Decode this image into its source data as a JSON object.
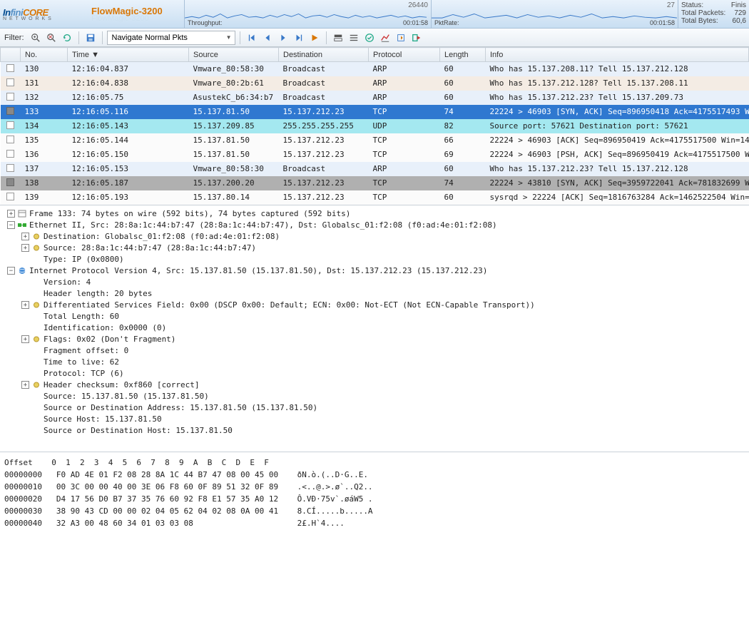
{
  "logo": {
    "in": "In",
    "fini": "fini",
    "core": "CORE",
    "sub": "N E T W O R K S"
  },
  "product": {
    "name": "FlowMagic-3200",
    "shadow": "FlowMagic-3200"
  },
  "stats": {
    "throughput": {
      "value": "26440",
      "label": "Throughput:",
      "time": "00:01:58"
    },
    "pktrate": {
      "value": "27",
      "label": "PktRate:",
      "time": "00:01:58"
    }
  },
  "status": {
    "status_label": "Status:",
    "status_val": "Finis",
    "packets_label": "Total Packets:",
    "packets_val": "729",
    "bytes_label": "Total Bytes:",
    "bytes_val": "60,6"
  },
  "toolbar": {
    "filter_label": "Filter:",
    "nav_select": "Navigate Normal Pkts"
  },
  "columns": {
    "check": " ",
    "no": "No.",
    "time": "Time ▼",
    "source": "Source",
    "dest": "Destination",
    "proto": "Protocol",
    "len": "Length",
    "info": "Info"
  },
  "packets": [
    {
      "chk": false,
      "cls": "row-lightblue",
      "no": "130",
      "time": "12:16:04.837",
      "src": "Vmware_80:58:30",
      "dst": "Broadcast",
      "proto": "ARP",
      "len": "60",
      "info": "Who has 15.137.208.11? Tell 15.137.212.128"
    },
    {
      "chk": false,
      "cls": "row-pale",
      "no": "131",
      "time": "12:16:04.838",
      "src": "Vmware_80:2b:61",
      "dst": "Broadcast",
      "proto": "ARP",
      "len": "60",
      "info": "Who has 15.137.212.128? Tell 15.137.208.11"
    },
    {
      "chk": false,
      "cls": "row-lightblue",
      "no": "132",
      "time": "12:16:05.75",
      "src": "AsustekC_b6:34:b7",
      "dst": "Broadcast",
      "proto": "ARP",
      "len": "60",
      "info": "Who has 15.137.212.23? Tell 15.137.209.73"
    },
    {
      "chk": true,
      "cls": "row-selected",
      "no": "133",
      "time": "12:16:05.116",
      "src": "15.137.81.50",
      "dst": "15.137.212.23",
      "proto": "TCP",
      "len": "74",
      "info": "22224 > 46903 [SYN, ACK] Seq=896950418 Ack=4175517493 W"
    },
    {
      "chk": false,
      "cls": "row-cyan",
      "no": "134",
      "time": "12:16:05.143",
      "src": "15.137.209.85",
      "dst": "255.255.255.255",
      "proto": "UDP",
      "len": "82",
      "info": "Source port: 57621 Destination port: 57621"
    },
    {
      "chk": false,
      "cls": "row-white",
      "no": "135",
      "time": "12:16:05.144",
      "src": "15.137.81.50",
      "dst": "15.137.212.23",
      "proto": "TCP",
      "len": "66",
      "info": "22224 > 46903 [ACK] Seq=896950419 Ack=4175517500 Win=14"
    },
    {
      "chk": false,
      "cls": "row-white",
      "no": "136",
      "time": "12:16:05.150",
      "src": "15.137.81.50",
      "dst": "15.137.212.23",
      "proto": "TCP",
      "len": "69",
      "info": "22224 > 46903 [PSH, ACK] Seq=896950419 Ack=4175517500 W"
    },
    {
      "chk": false,
      "cls": "row-lightblue",
      "no": "137",
      "time": "12:16:05.153",
      "src": "Vmware_80:58:30",
      "dst": "Broadcast",
      "proto": "ARP",
      "len": "60",
      "info": "Who has 15.137.212.23? Tell 15.137.212.128"
    },
    {
      "chk": true,
      "cls": "row-gray",
      "no": "138",
      "time": "12:16:05.187",
      "src": "15.137.200.20",
      "dst": "15.137.212.23",
      "proto": "TCP",
      "len": "74",
      "info": "22224 > 43810 [SYN, ACK] Seq=3959722041 Ack=781832699 W"
    },
    {
      "chk": false,
      "cls": "row-white",
      "no": "139",
      "time": "12:16:05.193",
      "src": "15.137.80.14",
      "dst": "15.137.212.23",
      "proto": "TCP",
      "len": "60",
      "info": "sysrqd > 22224 [ACK] Seq=1816763284 Ack=1462522504 Win="
    }
  ],
  "details": [
    {
      "indent": 0,
      "tree": "plus",
      "icon": "frame",
      "text": "Frame 133: 74 bytes on wire (592 bits), 74 bytes captured (592 bits)"
    },
    {
      "indent": 0,
      "tree": "minus",
      "icon": "eth",
      "text": "Ethernet II, Src: 28:8a:1c:44:b7:47 (28:8a:1c:44:b7:47), Dst: Globalsc_01:f2:08 (f0:ad:4e:01:f2:08)"
    },
    {
      "indent": 1,
      "tree": "plus",
      "icon": "dot",
      "text": "Destination: Globalsc_01:f2:08 (f0:ad:4e:01:f2:08)"
    },
    {
      "indent": 1,
      "tree": "plus",
      "icon": "dot",
      "text": "Source: 28:8a:1c:44:b7:47 (28:8a:1c:44:b7:47)"
    },
    {
      "indent": 1,
      "tree": "none",
      "icon": "none",
      "text": "Type: IP (0x0800)"
    },
    {
      "indent": 0,
      "tree": "minus",
      "icon": "ip",
      "text": "Internet Protocol Version 4, Src: 15.137.81.50 (15.137.81.50), Dst: 15.137.212.23 (15.137.212.23)"
    },
    {
      "indent": 1,
      "tree": "none",
      "icon": "none",
      "text": "Version: 4"
    },
    {
      "indent": 1,
      "tree": "none",
      "icon": "none",
      "text": "Header length: 20 bytes"
    },
    {
      "indent": 1,
      "tree": "plus",
      "icon": "dot",
      "text": "Differentiated Services Field: 0x00 (DSCP 0x00: Default; ECN: 0x00: Not-ECT (Not ECN-Capable Transport))"
    },
    {
      "indent": 1,
      "tree": "none",
      "icon": "none",
      "text": "Total Length: 60"
    },
    {
      "indent": 1,
      "tree": "none",
      "icon": "none",
      "text": "Identification: 0x0000 (0)"
    },
    {
      "indent": 1,
      "tree": "plus",
      "icon": "dot",
      "text": "Flags: 0x02 (Don't Fragment)"
    },
    {
      "indent": 1,
      "tree": "none",
      "icon": "none",
      "text": "Fragment offset: 0"
    },
    {
      "indent": 1,
      "tree": "none",
      "icon": "none",
      "text": "Time to live: 62"
    },
    {
      "indent": 1,
      "tree": "none",
      "icon": "none",
      "text": "Protocol: TCP (6)"
    },
    {
      "indent": 1,
      "tree": "plus",
      "icon": "dot",
      "text": "Header checksum: 0xf860 [correct]"
    },
    {
      "indent": 1,
      "tree": "none",
      "icon": "none",
      "text": "Source: 15.137.81.50 (15.137.81.50)"
    },
    {
      "indent": 1,
      "tree": "none",
      "icon": "none",
      "text": "Source or Destination Address: 15.137.81.50 (15.137.81.50)"
    },
    {
      "indent": 1,
      "tree": "none",
      "icon": "none",
      "text": "Source Host: 15.137.81.50"
    },
    {
      "indent": 1,
      "tree": "none",
      "icon": "none",
      "text": "Source or Destination Host: 15.137.81.50"
    }
  ],
  "hex": {
    "header": "Offset    0  1  2  3  4  5  6  7  8  9  A  B  C  D  E  F",
    "rows": [
      {
        "off": "00000000",
        "bytes": "F0 AD 4E 01 F2 08 28 8A 1C 44 B7 47 08 00 45 00",
        "ascii": "ðN.ò.(..D·G..E."
      },
      {
        "off": "00000010",
        "bytes": "00 3C 00 00 40 00 3E 06 F8 60 0F 89 51 32 0F 89",
        "ascii": ".<..@.>.ø`..Q2.."
      },
      {
        "off": "00000020",
        "bytes": "D4 17 56 D0 B7 37 35 76 60 92 F8 E1 57 35 A0 12",
        "ascii": "Ô.VÐ·75v`.øáW5 ."
      },
      {
        "off": "00000030",
        "bytes": "38 90 43 CD 00 00 02 04 05 62 04 02 08 0A 00 41",
        "ascii": "8.CÍ.....b.....A"
      },
      {
        "off": "00000040",
        "bytes": "32 A3 00 48 60 34 01 03 03 08",
        "ascii": "2£.H`4...."
      }
    ]
  }
}
